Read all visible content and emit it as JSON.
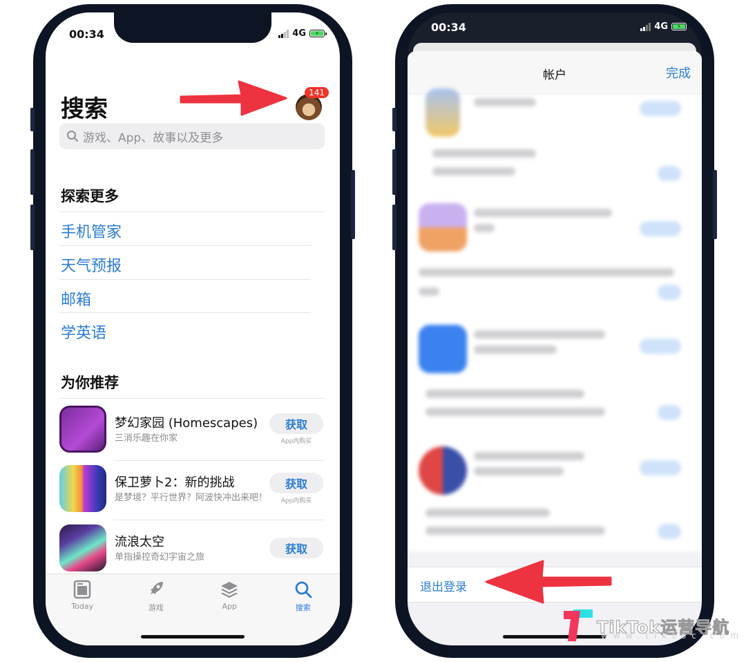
{
  "left_phone": {
    "status_bar": {
      "time": "00:34",
      "network": "4G"
    },
    "page_title": "搜索",
    "account_badge_count": "141",
    "search": {
      "placeholder": "游戏、App、故事以及更多"
    },
    "explore": {
      "heading": "探索更多",
      "links": [
        "手机管家",
        "天气预报",
        "邮箱",
        "学英语"
      ]
    },
    "recommend": {
      "heading": "为你推荐",
      "apps": [
        {
          "name": "梦幻家园 (Homescapes)",
          "subtitle": "三消乐趣在你家",
          "button": "获取",
          "note": "App内购买"
        },
        {
          "name": "保卫萝卜2：新的挑战",
          "subtitle": "是梦境？平行世界？阿波快冲出来吧！",
          "button": "获取",
          "note": "App内购买"
        },
        {
          "name": "流浪太空",
          "subtitle": "单指操控奇幻宇宙之旅",
          "button": "获取",
          "note": ""
        }
      ]
    },
    "tabbar": {
      "tabs": [
        {
          "label": "Today",
          "icon": "today-icon",
          "active": false
        },
        {
          "label": "游戏",
          "icon": "rocket-icon",
          "active": false
        },
        {
          "label": "App",
          "icon": "layers-icon",
          "active": false
        },
        {
          "label": "搜索",
          "icon": "search-icon",
          "active": true
        }
      ]
    }
  },
  "right_phone": {
    "status_bar": {
      "time": "00:34",
      "network": "4G"
    },
    "sheet": {
      "title": "帐户",
      "done_label": "完成",
      "sign_out_label": "退出登录"
    }
  },
  "watermark": {
    "brand": "TikTok运营导航",
    "url": "www.tiktoc.com"
  },
  "colors": {
    "accent": "#2a7cd4",
    "annotation_arrow": "#ee3340",
    "badge": "#f0352b",
    "frame": "#0d1424"
  }
}
